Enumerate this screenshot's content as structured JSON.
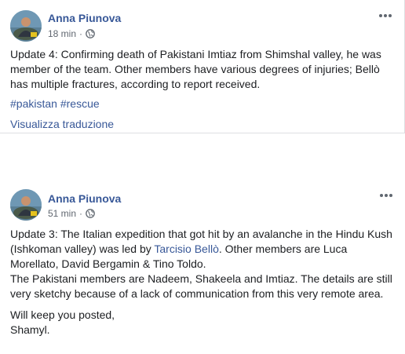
{
  "posts": [
    {
      "author": "Anna Piunova",
      "time": "18 min",
      "privacy_icon": "globe-icon",
      "lines": [
        "Update 4: Confirming death of Pakistani Imtiaz from Shimshal valley, he was",
        "member of the team. Other members have various degrees of injuries; Bellò",
        "has multiple fractures, according to report received."
      ],
      "hashtags": [
        "#pakistan",
        "#rescue"
      ],
      "translate_label": "Visualizza traduzione"
    },
    {
      "author": "Anna Piunova",
      "time": "51 min",
      "privacy_icon": "globe-icon",
      "para1": {
        "line1": "Update 3: The Italian expedition that got hit by an avalanche in the Hindu Kush",
        "line2_before": "(Ishkoman valley) was led by ",
        "line2_link": "Tarcisio Bellò",
        "line2_after": ". Other members are Luca",
        "line3": "Morellato, David Bergamin & Tino Toldo.",
        "line4": "The Pakistani members are Nadeem, Shakeela and Imtiaz. The details are still",
        "line5": "very sketchy because of a lack of communication from this very remote area."
      },
      "para2": {
        "line1": "Will keep you posted,",
        "line2": "Shamyl."
      }
    }
  ],
  "colors": {
    "link": "#385898",
    "text": "#1c1e21",
    "meta": "#606770"
  }
}
